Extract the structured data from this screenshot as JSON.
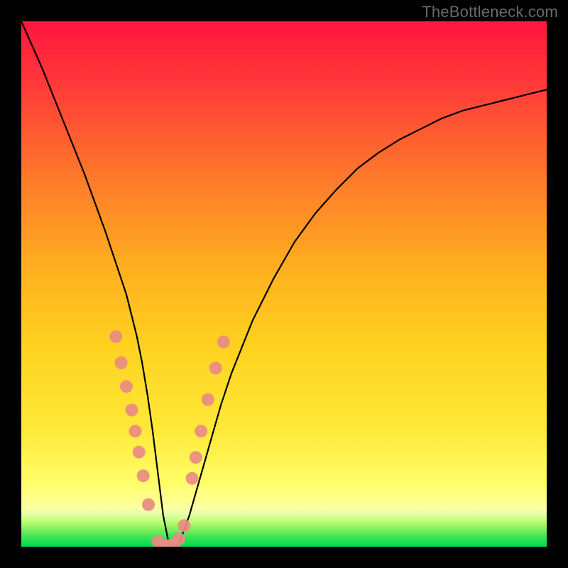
{
  "watermark": "TheBottleneck.com",
  "chart_data": {
    "type": "line",
    "title": "",
    "xlabel": "",
    "ylabel": "",
    "xlim": [
      0,
      100
    ],
    "ylim": [
      0,
      100
    ],
    "grid": false,
    "legend": false,
    "background_gradient": {
      "top": "#ff1a3f",
      "middle": "#ffd21f",
      "lower": "#ffff66",
      "bottom_band": "#bfff66",
      "bottom": "#00e054"
    },
    "series": [
      {
        "name": "curve",
        "x": [
          0,
          2,
          4,
          6,
          8,
          10,
          12,
          14,
          16,
          18,
          20,
          21,
          22,
          23,
          24,
          25,
          26,
          27,
          28,
          29,
          30,
          32,
          34,
          36,
          38,
          40,
          44,
          48,
          52,
          56,
          60,
          64,
          68,
          72,
          76,
          80,
          84,
          88,
          92,
          96,
          100
        ],
        "y": [
          100,
          95.5,
          91,
          86,
          81,
          76,
          71,
          65.5,
          60,
          54,
          48,
          44,
          40,
          35,
          29,
          22,
          14,
          6,
          1,
          0,
          0.5,
          6,
          13,
          20,
          27,
          33,
          43,
          51,
          58,
          63.5,
          68,
          72,
          75,
          77.5,
          79.5,
          81.5,
          83,
          84,
          85,
          86,
          87
        ],
        "color": "#000000"
      }
    ],
    "markers": {
      "name": "highlight-dots",
      "color": "#e98b83",
      "radius_px": 9,
      "points": [
        {
          "x": 18.0,
          "y": 40.0
        },
        {
          "x": 19.0,
          "y": 35.0
        },
        {
          "x": 20.0,
          "y": 30.5
        },
        {
          "x": 21.0,
          "y": 26.0
        },
        {
          "x": 21.7,
          "y": 22.0
        },
        {
          "x": 22.4,
          "y": 18.0
        },
        {
          "x": 23.2,
          "y": 13.5
        },
        {
          "x": 24.2,
          "y": 8.0
        },
        {
          "x": 26.0,
          "y": 1.0
        },
        {
          "x": 27.0,
          "y": 0.3
        },
        {
          "x": 28.0,
          "y": 0.2
        },
        {
          "x": 29.0,
          "y": 0.3
        },
        {
          "x": 30.0,
          "y": 1.5
        },
        {
          "x": 31.0,
          "y": 4.0
        },
        {
          "x": 32.5,
          "y": 13.0
        },
        {
          "x": 33.2,
          "y": 17.0
        },
        {
          "x": 34.2,
          "y": 22.0
        },
        {
          "x": 35.5,
          "y": 28.0
        },
        {
          "x": 37.0,
          "y": 34.0
        },
        {
          "x": 38.5,
          "y": 39.0
        }
      ]
    }
  }
}
